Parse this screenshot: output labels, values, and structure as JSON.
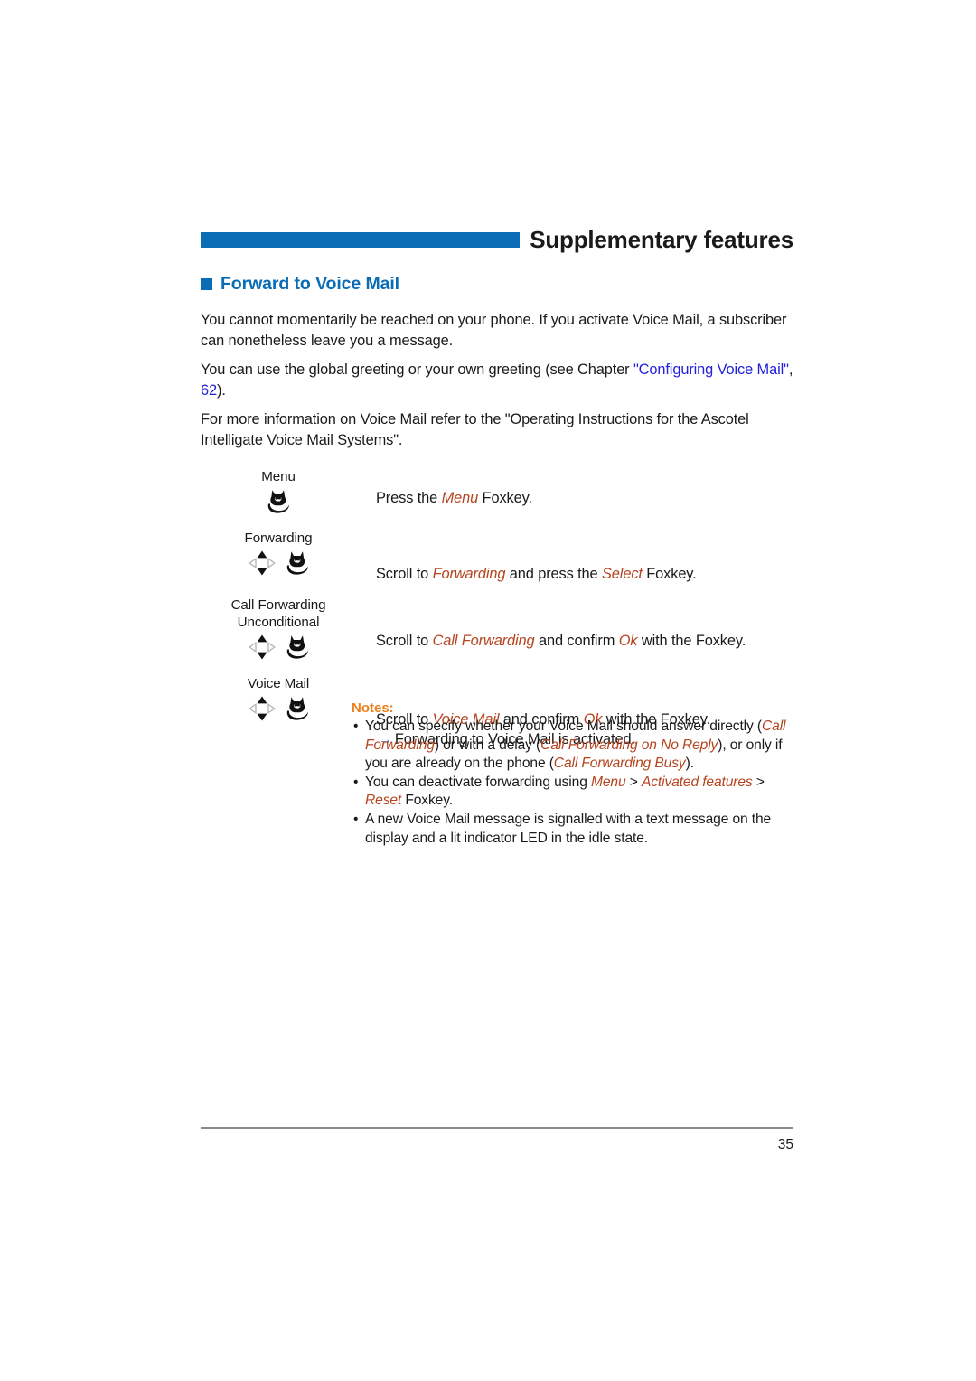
{
  "header": {
    "title": "Supplementary features"
  },
  "section": {
    "marker_icon": "square-bullet-icon",
    "title": "Forward to Voice Mail"
  },
  "intro": {
    "p1": "You cannot momentarily be reached on your phone. If you activate Voice Mail, a subscriber can nonetheless leave you a message.",
    "p2_before": "You can use the global greeting or your own greeting (see Chapter ",
    "p2_link": "\"Configuring Voice Mail\"",
    "p2_mid": ", ",
    "p2_page": "62",
    "p2_after": ").",
    "p3": "For more information on Voice Mail refer to the \"Operating Instructions for the Ascotel Intelligate Voice Mail Systems\"."
  },
  "procedure": {
    "rows": [
      {
        "display_label": "Menu",
        "keys": [
          "foxkey-icon"
        ],
        "text_parts": [
          {
            "t": "Press the ",
            "style": "plain"
          },
          {
            "t": "Menu",
            "style": "em"
          },
          {
            "t": " Foxkey.",
            "style": "plain"
          }
        ],
        "result": null
      },
      {
        "display_label": "Forwarding",
        "keys": [
          "navigation-key-icon",
          "foxkey-icon"
        ],
        "text_parts": [
          {
            "t": "Scroll to ",
            "style": "plain"
          },
          {
            "t": "Forwarding",
            "style": "em"
          },
          {
            "t": " and press the ",
            "style": "plain"
          },
          {
            "t": "Select",
            "style": "em"
          },
          {
            "t": " Foxkey.",
            "style": "plain"
          }
        ],
        "result": null
      },
      {
        "display_label": "Call Forwarding\nUnconditional",
        "keys": [
          "navigation-key-icon",
          "foxkey-icon"
        ],
        "text_parts": [
          {
            "t": "Scroll to ",
            "style": "plain"
          },
          {
            "t": "Call Forwarding",
            "style": "em"
          },
          {
            "t": " and confirm ",
            "style": "plain"
          },
          {
            "t": "Ok",
            "style": "em"
          },
          {
            "t": " with the Foxkey.",
            "style": "plain"
          }
        ],
        "result": null
      },
      {
        "display_label": "Voice Mail",
        "keys": [
          "navigation-key-icon",
          "foxkey-icon"
        ],
        "text_parts": [
          {
            "t": "Scroll to ",
            "style": "plain"
          },
          {
            "t": "Voice Mail",
            "style": "em"
          },
          {
            "t": " and confirm ",
            "style": "plain"
          },
          {
            "t": "Ok",
            "style": "em"
          },
          {
            "t": " with the Foxkey.",
            "style": "plain"
          }
        ],
        "result": {
          "arrow": "→",
          "text": "Forwarding to Voice Mail is activated."
        }
      }
    ]
  },
  "notes": {
    "title": "Notes:",
    "bullet_glyph": "•",
    "items": [
      [
        {
          "t": "You can specify whether your Voice Mail should answer directly (",
          "style": "plain"
        },
        {
          "t": "Call Forwarding",
          "style": "em"
        },
        {
          "t": ") or with a delay (",
          "style": "plain"
        },
        {
          "t": "Call Forwarding on No Reply",
          "style": "em"
        },
        {
          "t": "), or only if you are already on the phone (",
          "style": "plain"
        },
        {
          "t": "Call Forwarding Busy",
          "style": "em"
        },
        {
          "t": ").",
          "style": "plain"
        }
      ],
      [
        {
          "t": "You can deactivate forwarding using ",
          "style": "plain"
        },
        {
          "t": "Menu",
          "style": "em"
        },
        {
          "t": " > ",
          "style": "plain"
        },
        {
          "t": "Activated features",
          "style": "em"
        },
        {
          "t": " > ",
          "style": "plain"
        },
        {
          "t": "Reset",
          "style": "em"
        },
        {
          "t": " Foxkey.",
          "style": "plain"
        }
      ],
      [
        {
          "t": "A new Voice Mail message is signalled with a text message on the display and a lit indicator LED in the idle state.",
          "style": "plain"
        }
      ]
    ]
  },
  "footer": {
    "page_number": "35"
  },
  "colors": {
    "brand_blue": "#0a6cb4",
    "xref_blue": "#2222dd",
    "accent_orange": "#ee7f1a",
    "emphasis_brick": "#b5441f",
    "rule_gray": "#8c8c8c",
    "arrow_blue": "#1a63c8"
  }
}
